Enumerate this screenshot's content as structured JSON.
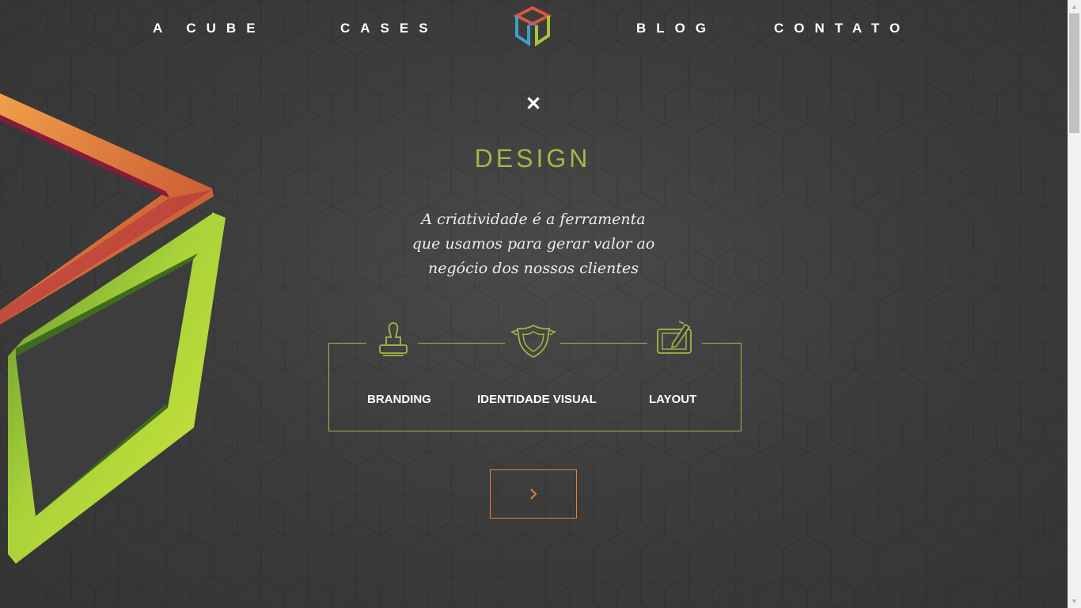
{
  "nav": {
    "items": [
      {
        "label": "A CUBE"
      },
      {
        "label": "CASES"
      },
      {
        "label": "BLOG"
      },
      {
        "label": "CONTATO"
      }
    ],
    "logo_icon": "cube-logo"
  },
  "panel": {
    "close_icon": "close-icon",
    "close_glyph": "✕",
    "title": "DESIGN",
    "subtitle_lines": [
      "A criatividade é a ferramenta",
      "que usamos para gerar valor ao",
      "negócio dos nossos clientes"
    ],
    "services": [
      {
        "label": "BRANDING",
        "icon": "stamp-icon"
      },
      {
        "label": "IDENTIDADE VISUAL",
        "icon": "shield-icon"
      },
      {
        "label": "LAYOUT",
        "icon": "tablet-pen-icon"
      }
    ],
    "next_icon": "chevron-right-icon"
  },
  "colors": {
    "accent_green": "#a7b545",
    "accent_orange": "#e3833a",
    "background": "#3d3d3d",
    "text": "#ffffff"
  }
}
